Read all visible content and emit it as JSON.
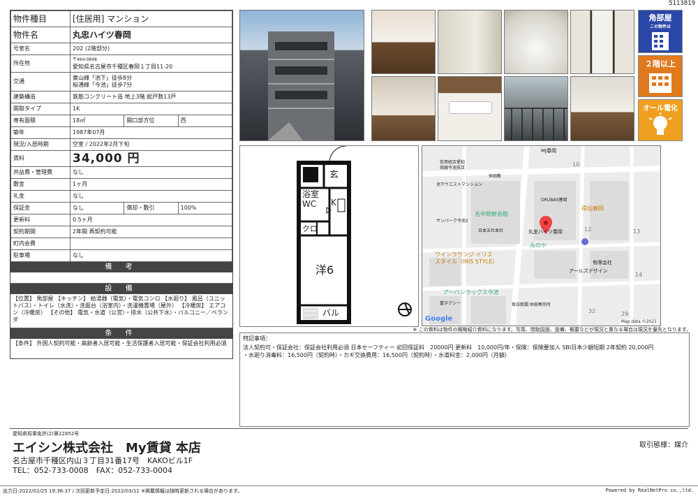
{
  "doc_id": "5113819",
  "spec": {
    "rows": {
      "type_k": "物件種目",
      "type_v": "[住居用] マンション",
      "name_k": "物件名",
      "name_v": "丸忠ハイツ春岡",
      "room_k": "号室名",
      "room_v": "202 (2階部分)",
      "addr_k": "所在地",
      "addr_zip": "〒464-0848",
      "addr_v": "愛知県名古屋市千種区春岡１丁目11-20",
      "traffic_k": "交通",
      "traffic_1": "東山線「池下」徒歩8分",
      "traffic_2": "桜通線「今池」徒歩7分",
      "struct_k": "建築構造",
      "struct_v": "鉄筋コンクリート造 地上3階 総戸数13戸",
      "layout_k": "間取タイプ",
      "layout_v": "1K",
      "area_k": "専有面積",
      "area_v": "18㎡",
      "dir_k": "開口部方位",
      "dir_v": "西",
      "built_k": "築年",
      "built_v": "1987年07月",
      "status_k": "現況/入居時期",
      "status_v": "空室 / 2022年2月下旬",
      "rent_k": "賃料",
      "rent_v": "34,000 円",
      "fee_k": "共益費・管理費",
      "fee_v": "なし",
      "deposit_k": "敷金",
      "deposit_v": "1ヶ月",
      "keymoney_k": "礼金",
      "keymoney_v": "なし",
      "guarantee_k": "保証金",
      "guarantee_v": "なし",
      "amort_k": "償却・敷引",
      "amort_v": "100%",
      "renew_k": "更新料",
      "renew_v": "0.5ヶ月",
      "contract_k": "契約期間",
      "contract_v": "2年間 再契約可能",
      "town_k": "町内会費",
      "town_v": "",
      "parking_k": "駐車場",
      "parking_v": "なし"
    },
    "remarks_title": "備 考",
    "equip_title": "設 備",
    "equip_text": "【位置】 角部屋 【キッチン】 給湯器（電気）・電気コンロ 【水廻り】 風呂（ユニットバス）・トイレ（水洗）・洗面台（浴室内）・洗濯機置場（屋外） 【冷暖房】 エアコン（冷暖房） 【その他】 電気・水道（公営）・排水（公共下水）・バルコニー／ベランダ",
    "cond_title": "条 件",
    "cond_text": "【条件】 外国人契約可能・高齢者入居可能・生活保護者入居可能・保証会社利用必須"
  },
  "badges": [
    {
      "label": "角部屋",
      "sub": "この物件は",
      "color": "#2a47a8"
    },
    {
      "label": "２階以上",
      "sub": "",
      "color": "#e07a1f"
    },
    {
      "label": "オール電化",
      "sub": "",
      "color": "#f0a020"
    }
  ],
  "plan": {
    "genkan": "玄",
    "bath": "浴室",
    "wc": "WC",
    "kitchen": "K",
    "closet": "クロ",
    "western": "洋6",
    "balcony": "バル"
  },
  "map": {
    "labels": [
      "MJ春岡",
      "信用組合愛知",
      "商銀今池支店",
      "仲田教",
      "池下ウエストマンション",
      "ORUBAS春岡",
      "得仙春岡",
      "サンパーク今池2",
      "名中朝鮮会館",
      "丸忠ハイツ春岡",
      "日本五仕本社",
      "みのや",
      "有限会社",
      "アールズデザイン",
      "ワインラウンジ イリス",
      "スタイル（IRIS STYLE）",
      "アーバンラックス今池",
      "富タクシー",
      "毎日新聞 仲田専売所"
    ],
    "numbers": [
      "10",
      "12",
      "13",
      "14",
      "32",
      "29"
    ],
    "google": "Google",
    "credit": "Map data ©2021"
  },
  "disclaimer": "※ この資料は物件の概略紹介資料になります。写真、間取図面、設備、概要などが現況と異なる場合は現況を優先となります。",
  "notes": {
    "title": "特記事項：",
    "line1": "法人契約可・保証会社：保証会社利用必須 日本セーフティー 初回保証料　20000円 更新料　10,000円/年・保険：保険要加入 SBI日本少額短期 2年契約 20,000円",
    "line2": "・水廻り消毒料：16,500円（契約時）・カギ交換費用：16,500円（契約時）・水道料金：2,000円（月額）"
  },
  "company": {
    "license": "愛知県知事免許(2)第22852号",
    "name": "エイシン株式会社　My賃貸 本店",
    "address": "名古屋市千種区内山３丁目31番17号　KAKOビル1F",
    "phone": "TEL：052-733-0008　FAX：052-733-0004",
    "deal_type": "取引態様：媒介"
  },
  "bottom": {
    "left": "出力日:2022/02/25 19:38:37 / 次回更新予定日:2022/03/11 ※掲載情報は随時更新される場合があります。",
    "right": "Powered by RealNetPro co.,ltd."
  }
}
